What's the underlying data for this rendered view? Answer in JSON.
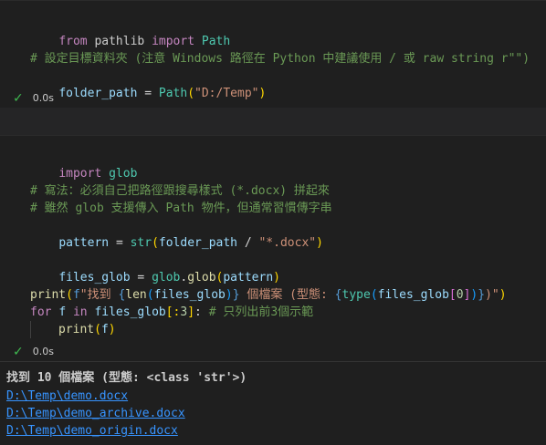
{
  "cell1": {
    "line1": {
      "kw1": "from",
      "mod": "pathlib",
      "kw2": "import",
      "cls": "Path"
    },
    "comment": "# 設定目標資料夾 (注意 Windows 路徑在 Python 中建議使用 / 或 raw string r\"\")",
    "line3": {
      "var": "folder_path",
      "op": "=",
      "cls": "Path",
      "lp": "(",
      "str": "\"D:/Temp\"",
      "rp": ")"
    },
    "exec_time": "0.0s"
  },
  "cell2": {
    "import_kw": "import",
    "import_mod": "glob",
    "comment1": "# 寫法：必須自己把路徑跟搜尋樣式 (*.docx) 拼起來",
    "comment2": "# 雖然 glob 支援傳入 Path 物件，但通常習慣傳字串",
    "pattern": {
      "var": "pattern",
      "eq": "=",
      "fn": "str",
      "lp": "(",
      "arg": "folder_path",
      "slash": "/",
      "str": "\"*.docx\"",
      "rp": ")"
    },
    "files": {
      "var": "files_glob",
      "eq": "=",
      "mod": "glob",
      "dot": ".",
      "fn": "glob",
      "lp": "(",
      "arg": "pattern",
      "rp": ")"
    },
    "print1": {
      "fn": "print",
      "lp": "(",
      "f": "f",
      "s1": "\"找到 ",
      "b1o": "{",
      "len": "len",
      "l2": "(",
      "arg1": "files_glob",
      "r2": ")",
      "b1c": "}",
      "s2": " 個檔案 (型態: ",
      "b2o": "{",
      "type": "type",
      "l3": "(",
      "arg2": "files_glob",
      "ix": "[",
      "zero": "0",
      "ixc": "]",
      "r3": ")",
      "b2c": "}",
      "s3": ")\"",
      "rp": ")"
    },
    "for": {
      "kw": "for",
      "var": "f",
      "in": "in",
      "arg": "files_glob",
      "sl": "[:",
      "num": "3",
      "slc": "]",
      "colon": ":",
      "comment": "# 只列出前3個示範"
    },
    "print2": {
      "fn": "print",
      "lp": "(",
      "arg": "f",
      "rp": ")"
    },
    "exec_time": "0.0s"
  },
  "output": {
    "header": "找到 10 個檔案 (型態: <class 'str'>)",
    "files": [
      "D:\\Temp\\demo.docx",
      "D:\\Temp\\demo_archive.docx",
      "D:\\Temp\\demo_origin.docx"
    ]
  },
  "colors": {
    "background": "#1f1f1f",
    "keyword": "#c586c0",
    "class": "#4ec9b0",
    "function": "#dcdcaa",
    "variable": "#9cdcfe",
    "string": "#ce9178",
    "comment": "#6a9955",
    "success": "#3fb950",
    "link": "#3794ff"
  }
}
